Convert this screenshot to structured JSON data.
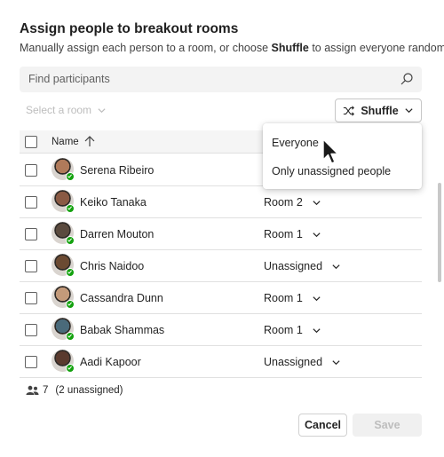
{
  "dialog": {
    "title": "Assign people to breakout rooms",
    "subtitle_prefix": "Manually assign each person to a room, or choose ",
    "subtitle_bold": "Shuffle",
    "subtitle_suffix": " to assign everyone randomly."
  },
  "search": {
    "placeholder": "Find participants",
    "icon": "search-icon"
  },
  "toolbar": {
    "select_room_label": "Select a room",
    "shuffle_label": "Shuffle"
  },
  "table": {
    "name_header": "Name",
    "rows": [
      {
        "name": "Serena Ribeiro",
        "room": "",
        "avatar_color": "#b07a5a"
      },
      {
        "name": "Keiko Tanaka",
        "room": "Room 2",
        "avatar_color": "#8a5a44"
      },
      {
        "name": "Darren Mouton",
        "room": "Room 1",
        "avatar_color": "#5a4a3e"
      },
      {
        "name": "Chris Naidoo",
        "room": "Unassigned",
        "avatar_color": "#6b4a32"
      },
      {
        "name": "Cassandra Dunn",
        "room": "Room 1",
        "avatar_color": "#c39a7a"
      },
      {
        "name": "Babak Shammas",
        "room": "Room 1",
        "avatar_color": "#4a6a7a"
      },
      {
        "name": "Aadi Kapoor",
        "room": "Unassigned",
        "avatar_color": "#5a3a2e"
      }
    ]
  },
  "shuffle_menu": {
    "options": [
      "Everyone",
      "Only unassigned people"
    ]
  },
  "footer": {
    "count": "7",
    "unassigned": "(2 unassigned)",
    "cancel_label": "Cancel",
    "save_label": "Save"
  },
  "colors": {
    "presence": "#13a10e",
    "disabled": "#bdbdbd"
  }
}
